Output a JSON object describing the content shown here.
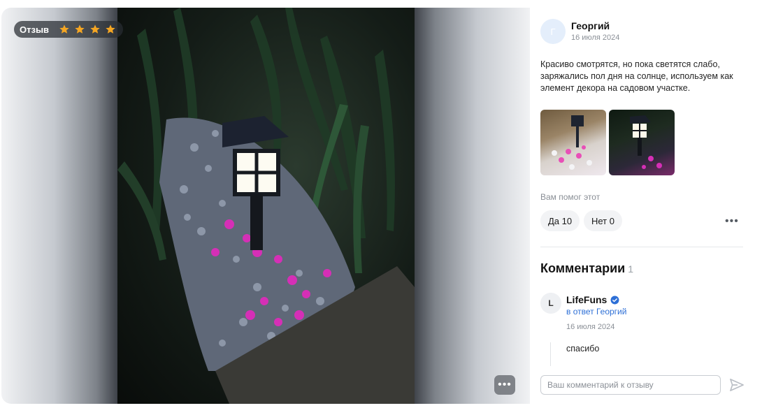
{
  "media": {
    "badge_label": "Отзыв",
    "rating": 4,
    "rating_max": 4,
    "more_label": "•••"
  },
  "review": {
    "avatar_letter": "Г",
    "author": "Георгий",
    "date": "16 июля 2024",
    "text": "Красиво смотрятся, но пока светятся слабо, заряжались пол дня на солнце, используем как элемент декора на садовом участке.",
    "helpful_prompt": "Вам помог этот",
    "yes_label": "Да 10",
    "no_label": "Нет 0",
    "more_label": "•••"
  },
  "comments": {
    "title": "Комментарии",
    "count": "1",
    "items": [
      {
        "avatar_letter": "L",
        "author": "LifeFuns",
        "reply_to": "в ответ Георгий",
        "date": "16 июля 2024",
        "text": "спасибо"
      }
    ],
    "input_placeholder": "Ваш комментарий к отзыву"
  },
  "colors": {
    "accent_blue": "#2d6fd6",
    "star": "#f5a623",
    "badge_bg": "#2c3036"
  },
  "icons": {
    "star": "star-icon",
    "verified": "verified-check-icon",
    "send": "send-icon",
    "more": "more-dots-icon"
  }
}
